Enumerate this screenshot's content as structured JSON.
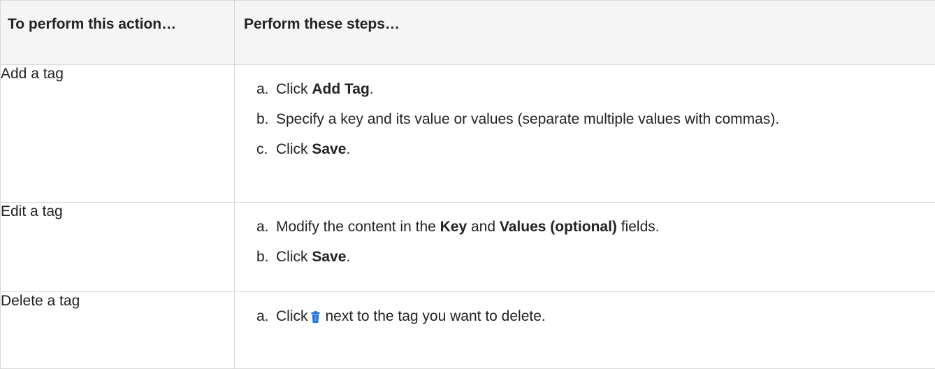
{
  "table": {
    "headers": {
      "action": "To perform this action…",
      "steps": "Perform these steps…"
    },
    "rows": [
      {
        "action": "Add a tag",
        "steps": [
          {
            "letter": "a.",
            "pre": "Click ",
            "bold": "Add Tag",
            "post": "."
          },
          {
            "letter": "b.",
            "text": "Specify a key and its value or values (separate multiple values with commas)."
          },
          {
            "letter": "c.",
            "pre": "Click ",
            "bold": "Save",
            "post": "."
          }
        ]
      },
      {
        "action": "Edit a tag",
        "steps": [
          {
            "letter": "a.",
            "pre": "Modify the content in the ",
            "bold1": "Key",
            "mid": " and ",
            "bold2": "Values (optional)",
            "post": " fields."
          },
          {
            "letter": "b.",
            "pre": "Click ",
            "bold": "Save",
            "post": "."
          }
        ]
      },
      {
        "action": "Delete a tag",
        "steps": [
          {
            "letter": "a.",
            "pre": "Click",
            "icon": "trash-icon",
            "post": "next to the tag you want to delete."
          }
        ]
      }
    ]
  },
  "colors": {
    "header_bg": "#f5f5f5",
    "border": "#d9d9d9",
    "text": "#222222",
    "trash_icon": "#1e6fe0"
  }
}
